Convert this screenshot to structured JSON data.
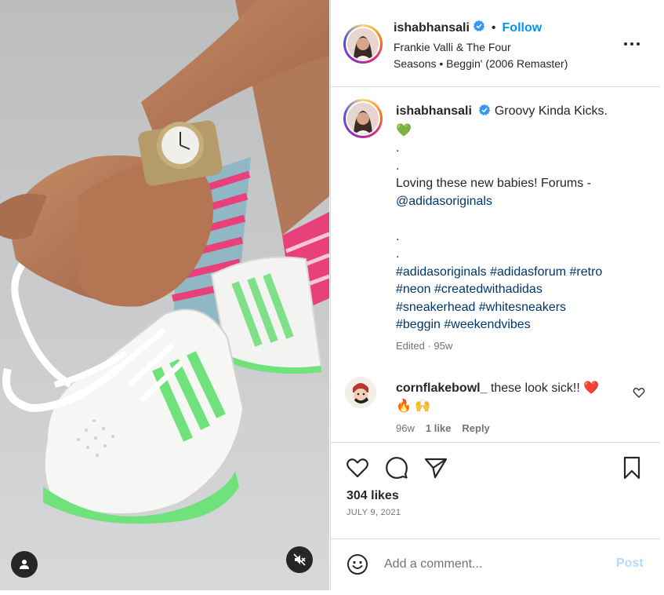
{
  "post": {
    "username": "ishabhansali",
    "follow_label": "Follow",
    "separator": "•",
    "audio_line1": "Frankie Valli & The Four",
    "audio_line2": "Seasons • Beggin' (2006 Remaster)",
    "more_icon": "more-horizontal-icon"
  },
  "caption": {
    "username": "ishabhansali",
    "title": "Groovy Kinda Kicks.",
    "heart_emoji": "💚",
    "dot1": ".",
    "dot2": ".",
    "line1": "Loving these new babies! Forums -",
    "mention": "@adidasoriginals",
    "dot3": ".",
    "dot4": ".",
    "hashtags": [
      "#adidasoriginals",
      "#adidasforum",
      "#retro",
      "#neon",
      "#createdwithadidas",
      "#sneakerhead",
      "#whitesneakers",
      "#beggin",
      "#weekendvibes"
    ],
    "edited": "Edited · 95w"
  },
  "comment": {
    "username": "cornflakebowl_",
    "text": "these look sick!!",
    "emojis_inline": "❤️",
    "emojis_line2": "🔥 🙌",
    "time": "96w",
    "likes": "1 like",
    "reply": "Reply"
  },
  "stats": {
    "likes": "304 likes",
    "date": "JULY 9, 2021"
  },
  "composer": {
    "placeholder": "Add a comment...",
    "post_label": "Post"
  },
  "colors": {
    "accent": "#0095f6",
    "link": "#00376b",
    "muted": "#737373",
    "post_disabled": "#b3dbff",
    "verified": "#3897f0"
  }
}
